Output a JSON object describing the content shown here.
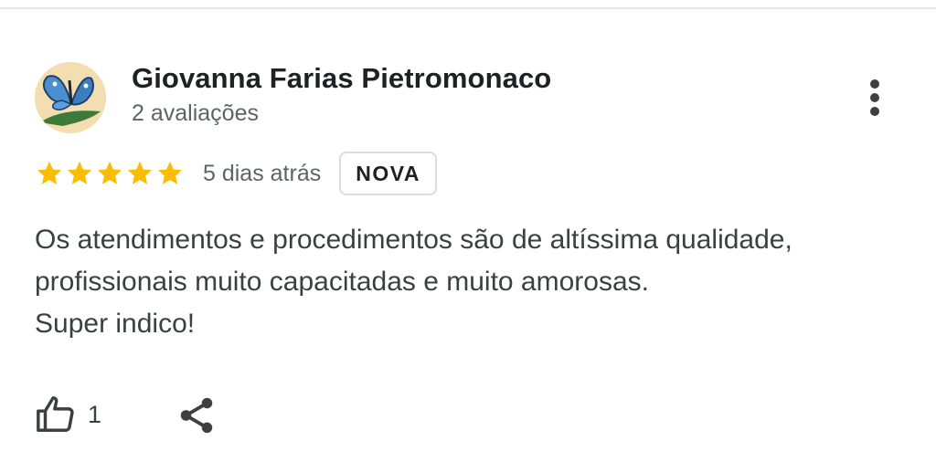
{
  "review": {
    "reviewer_name": "Giovanna Farias Pietromonaco",
    "reviewer_meta": "2 avaliações",
    "avatar_icon": "butterfly-avatar",
    "rating": 5,
    "rating_max": 5,
    "time_ago": "5 dias atrás",
    "badge": "NOVA",
    "text_lines": [
      "Os atendimentos e procedimentos são de altíssima qualidade,",
      "profissionais muito capacitadas e muito amorosas.",
      "Super indico!"
    ],
    "like_count": "1"
  },
  "icons": {
    "more": "more-vert-icon",
    "star": "star-icon",
    "like": "thumbs-up-icon",
    "share": "share-icon"
  },
  "colors": {
    "star": "#fbbc04",
    "text_primary": "#202124",
    "text_secondary": "#5f6368",
    "text_body": "#3c4043",
    "badge_border": "#dadce0",
    "divider": "#e6e6e6"
  }
}
